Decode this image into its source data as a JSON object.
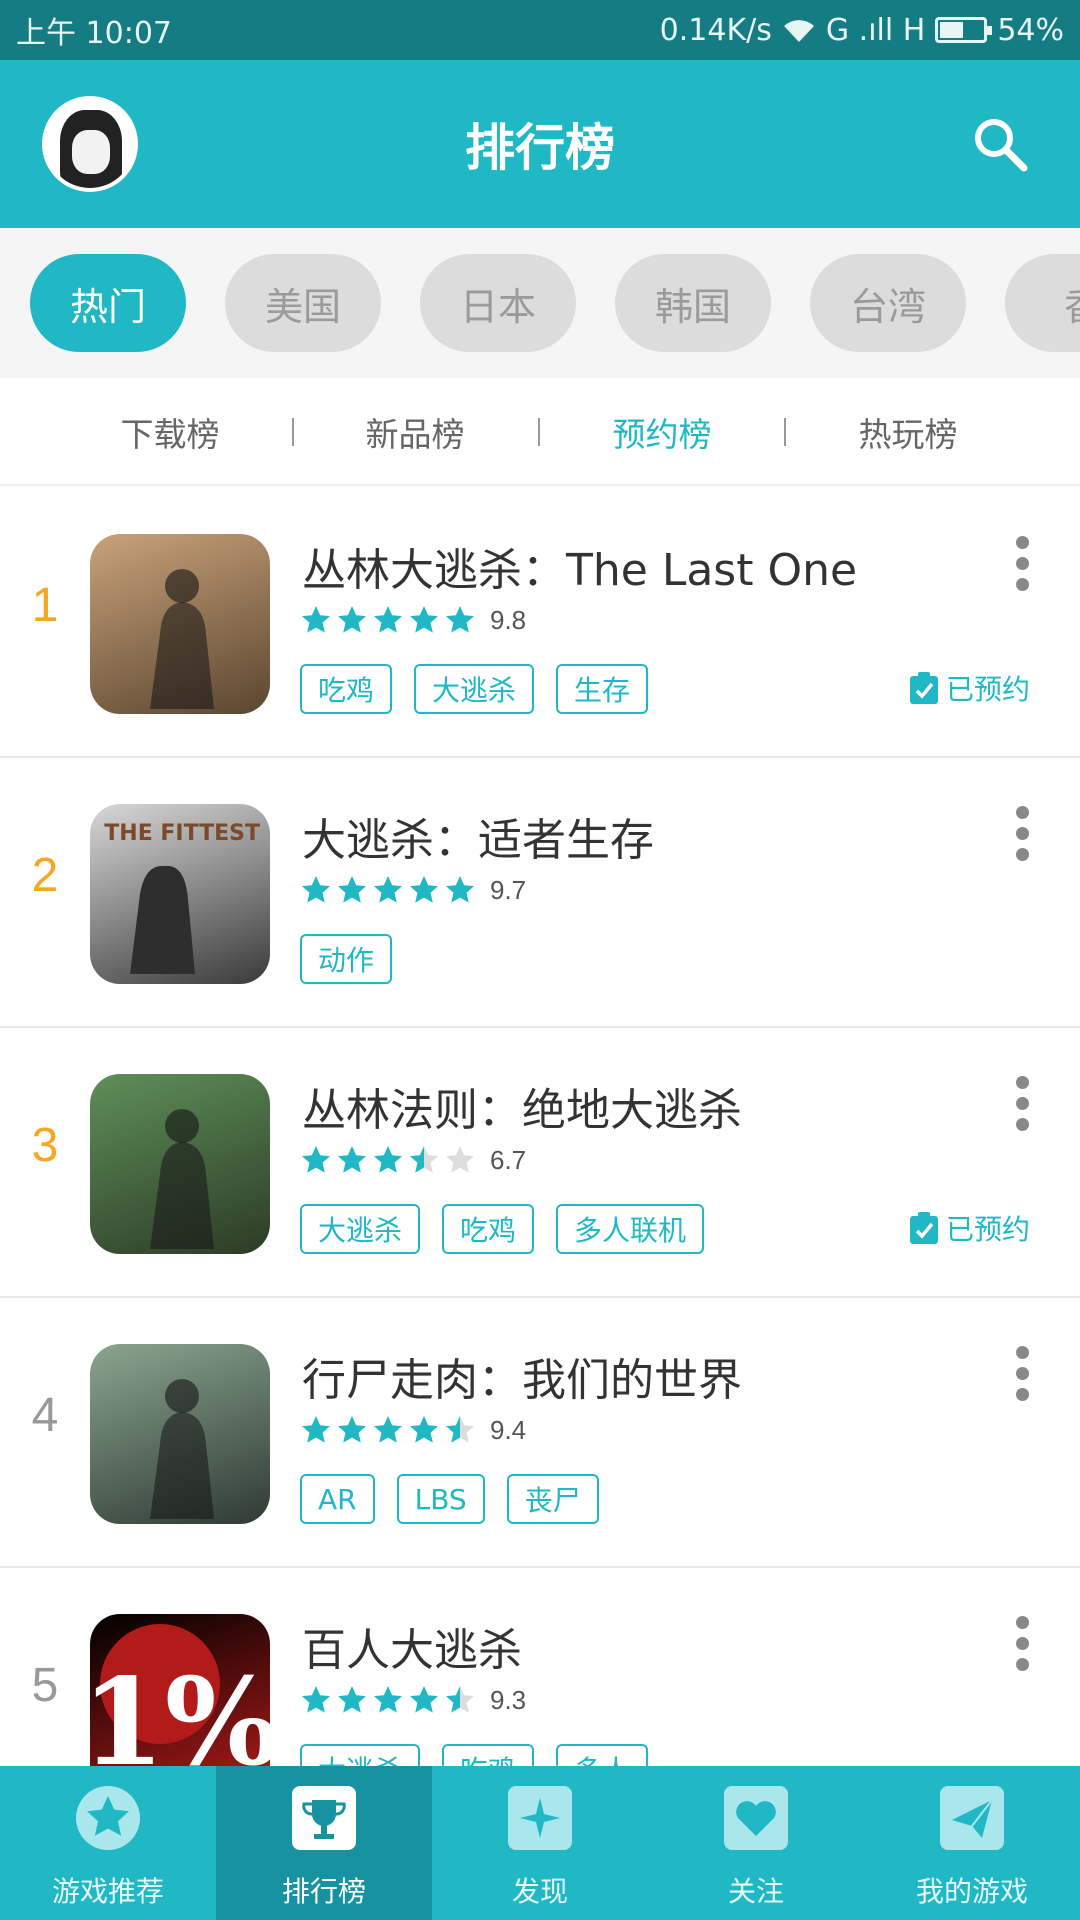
{
  "status_bar": {
    "time": "上午 10:07",
    "net_speed": "0.14K/s",
    "signal_text": "G .ıll H",
    "battery_level": 0.54,
    "battery": "54%"
  },
  "header": {
    "title": "排行榜"
  },
  "regions": [
    {
      "label": "热门",
      "active": true
    },
    {
      "label": "美国",
      "active": false
    },
    {
      "label": "日本",
      "active": false
    },
    {
      "label": "韩国",
      "active": false
    },
    {
      "label": "台湾",
      "active": false
    },
    {
      "label": "香",
      "active": false
    }
  ],
  "subtabs": [
    {
      "label": "下载榜",
      "active": false
    },
    {
      "label": "新品榜",
      "active": false
    },
    {
      "label": "预约榜",
      "active": true
    },
    {
      "label": "热玩榜",
      "active": false
    }
  ],
  "games": [
    {
      "rank": "1",
      "name": "丛林大逃杀：The Last One",
      "rating": 5,
      "score": "9.8",
      "tags": [
        "吃鸡",
        "大逃杀",
        "生存"
      ],
      "reserved": "已预约",
      "icon_colors": [
        "#c9a27a",
        "#5a4630"
      ]
    },
    {
      "rank": "2",
      "name": "大逃杀：适者生存",
      "rating": 5,
      "score": "9.7",
      "tags": [
        "动作"
      ],
      "reserved": "",
      "icon_text": "THE FITTEST",
      "icon_colors": [
        "#d8d8d8",
        "#3a3a3a"
      ]
    },
    {
      "rank": "3",
      "name": "丛林法则：绝地大逃杀",
      "rating": 3.5,
      "score": "6.7",
      "tags": [
        "大逃杀",
        "吃鸡",
        "多人联机"
      ],
      "reserved": "已预约",
      "icon_colors": [
        "#5f8f5a",
        "#2c3b26"
      ]
    },
    {
      "rank": "4",
      "name": "行尸走肉：我们的世界",
      "rating": 4.5,
      "score": "9.4",
      "tags": [
        "AR",
        "LBS",
        "丧尸"
      ],
      "reserved": "",
      "icon_colors": [
        "#8aa58f",
        "#2f3a34"
      ]
    },
    {
      "rank": "5",
      "name": "百人大逃杀",
      "rating": 4.5,
      "score": "9.3",
      "tags": [
        "大逃杀",
        "吃鸡",
        "多人"
      ],
      "reserved": "",
      "icon_text": "1%",
      "icon_colors": [
        "#000000",
        "#b31b1b"
      ]
    }
  ],
  "bottom_nav": [
    {
      "label": "游戏推荐",
      "icon": "star-icon",
      "active": false
    },
    {
      "label": "排行榜",
      "icon": "trophy-icon",
      "active": true
    },
    {
      "label": "发现",
      "icon": "sparkle-icon",
      "active": false
    },
    {
      "label": "关注",
      "icon": "heart-icon",
      "active": false
    },
    {
      "label": "我的游戏",
      "icon": "paper-plane-icon",
      "active": false
    }
  ],
  "colors": {
    "accent": "#1fb8c4",
    "status_bar": "#147c82",
    "rank_top": "#f5a623",
    "nav_active": "#1792a0"
  }
}
